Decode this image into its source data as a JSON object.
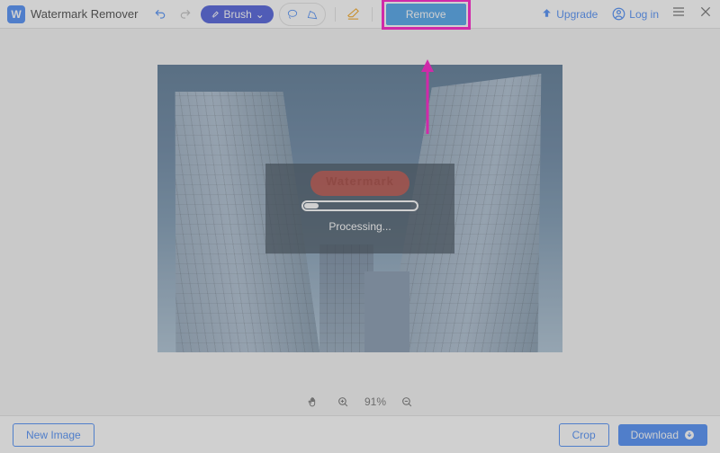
{
  "app": {
    "title": "Watermark Remover"
  },
  "toolbar": {
    "brush_label": "Brush",
    "remove_label": "Remove",
    "upgrade_label": "Upgrade",
    "login_label": "Log in"
  },
  "canvas": {
    "watermark_text": "Watermark",
    "status_text": "Processing..."
  },
  "zoom": {
    "percent": "91%"
  },
  "footer": {
    "new_image_label": "New Image",
    "crop_label": "Crop",
    "download_label": "Download"
  }
}
